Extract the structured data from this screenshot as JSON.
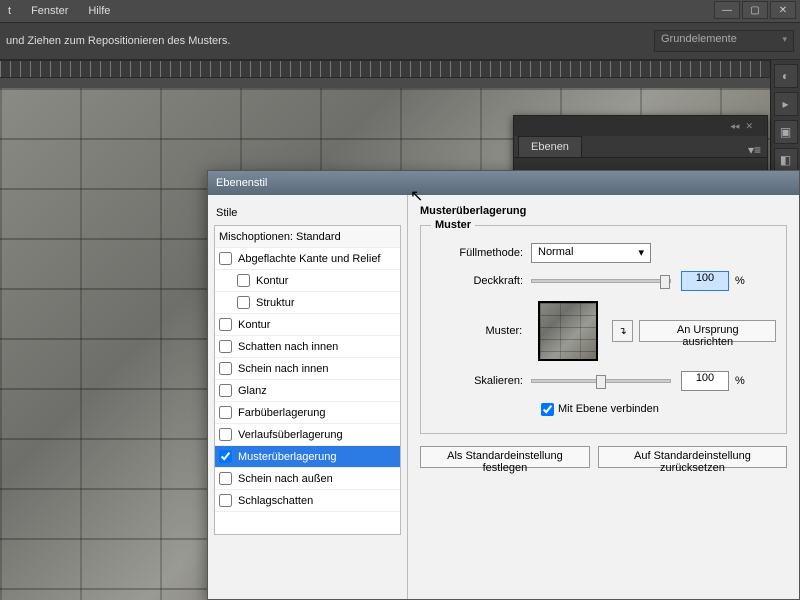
{
  "menubar": {
    "items": [
      "t",
      "Fenster",
      "Hilfe"
    ]
  },
  "toolbar": {
    "hint": "und Ziehen zum Repositionieren des Musters.",
    "workspace": "Grundelemente"
  },
  "panels": {
    "layers_tab": "Ebenen"
  },
  "dialog": {
    "title": "Ebenenstil",
    "styles_header": "Stile",
    "blending_row": "Mischoptionen: Standard",
    "items": [
      {
        "label": "Abgeflachte Kante und Relief",
        "checked": false,
        "indent": false
      },
      {
        "label": "Kontur",
        "checked": false,
        "indent": true
      },
      {
        "label": "Struktur",
        "checked": false,
        "indent": true
      },
      {
        "label": "Kontur",
        "checked": false,
        "indent": false
      },
      {
        "label": "Schatten nach innen",
        "checked": false,
        "indent": false
      },
      {
        "label": "Schein nach innen",
        "checked": false,
        "indent": false
      },
      {
        "label": "Glanz",
        "checked": false,
        "indent": false
      },
      {
        "label": "Farbüberlagerung",
        "checked": false,
        "indent": false
      },
      {
        "label": "Verlaufsüberlagerung",
        "checked": false,
        "indent": false
      },
      {
        "label": "Musterüberlagerung",
        "checked": true,
        "indent": false,
        "selected": true
      },
      {
        "label": "Schein nach außen",
        "checked": false,
        "indent": false
      },
      {
        "label": "Schlagschatten",
        "checked": false,
        "indent": false
      }
    ],
    "right": {
      "section_title": "Musterüberlagerung",
      "group_legend": "Muster",
      "blend_mode_label": "Füllmethode:",
      "blend_mode_value": "Normal",
      "opacity_label": "Deckkraft:",
      "opacity_value": "100",
      "pattern_label": "Muster:",
      "snap_origin_btn": "An Ursprung ausrichten",
      "scale_label": "Skalieren:",
      "scale_value": "100",
      "link_layer_label": "Mit Ebene verbinden",
      "link_layer_checked": true,
      "percent": "%",
      "default_btn": "Als Standardeinstellung festlegen",
      "reset_btn": "Auf Standardeinstellung zurücksetzen"
    }
  }
}
